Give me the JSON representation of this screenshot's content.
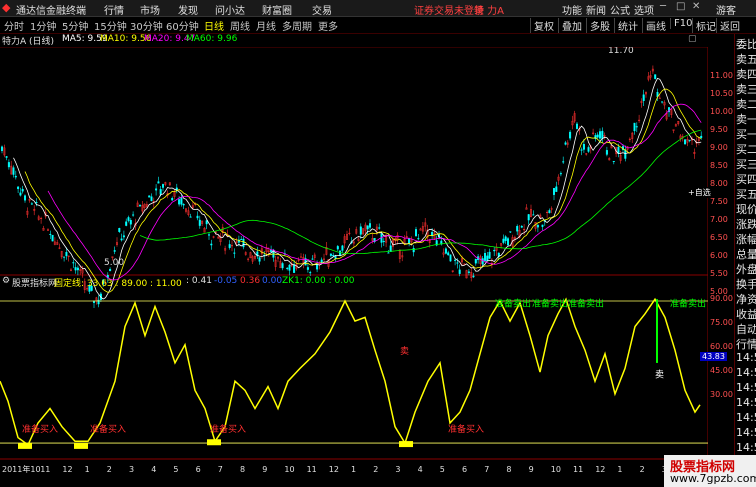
{
  "app": {
    "title": "通达信金融终端"
  },
  "menu": {
    "items": [
      "行情",
      "市场",
      "发现",
      "问小达",
      "财富圈",
      "交易"
    ]
  },
  "warning": "证券交易未登录",
  "current_stock": "特 力A",
  "right_menu": {
    "items": [
      "功能",
      "新闻",
      "公式",
      "选项"
    ],
    "user": "游客"
  },
  "toolbar": {
    "periods": [
      "分时",
      "1分钟",
      "5分钟",
      "15分钟",
      "30分钟",
      "60分钟",
      "日线",
      "周线",
      "月线",
      "多周期",
      "更多"
    ],
    "active": "日线",
    "tools": [
      "复权",
      "叠加",
      "多股",
      "统计",
      "画线",
      "F10",
      "标记",
      "返回"
    ]
  },
  "ma_header": {
    "stock": "特力A (日线)",
    "ma5": "MA5: 9.59",
    "ma10": "MA10: 9.56",
    "ma20": "MA20: 9.47",
    "ma60": "MA60: 9.96"
  },
  "price_axis": [
    "11.00",
    "10.50",
    "10.00",
    "9.50",
    "9.00",
    "8.50",
    "8.00",
    "7.50",
    "7.00",
    "6.50",
    "6.00",
    "5.50",
    "5.00"
  ],
  "price_labels": {
    "high": "11.70",
    "low": "5.00",
    "self_select": "+自选"
  },
  "indicator": {
    "title": "股票指标网",
    "fixed_line": "固定线: 33.63 : 89.00 : 11.00",
    "v1": ": 0.41",
    "v2": "-0.05",
    "v3": "0.36",
    "v4": "0.00",
    "zk": "ZK1: 0.00 : 0.00",
    "buy_label": "准备买入",
    "sell_label": "准备卖出",
    "sell_short": "卖",
    "axis": [
      "90.00",
      "75.00",
      "60.00",
      "45.00",
      "30.00"
    ],
    "current_val": "43.83"
  },
  "time_axis": [
    "2011年10",
    "11",
    "12",
    "1",
    "2",
    "3",
    "4",
    "5",
    "6",
    "7",
    "8",
    "9",
    "10",
    "11",
    "12",
    "1",
    "2",
    "3",
    "4",
    "5",
    "6",
    "7",
    "8",
    "9",
    "10",
    "11",
    "12",
    "1",
    "2",
    "3",
    "4",
    "5"
  ],
  "right_panel": [
    "委比",
    "卖五",
    "卖四",
    "卖三",
    "卖二",
    "卖一",
    "买一",
    "买二",
    "买三",
    "买四",
    "买五",
    "现价",
    "涨跌",
    "涨幅",
    "总量",
    "外盘",
    "换手",
    "净资",
    "收益",
    "自动",
    "行情",
    "14:5",
    "14:5",
    "14:5",
    "14:5",
    "14:5",
    "14:5",
    "14:5",
    "14:5"
  ],
  "watermark": {
    "line1": "股票指标网",
    "line2": "www.7gpzb.com"
  },
  "colors": {
    "up": "#ff3030",
    "down": "#00ffff",
    "ma5": "#ffffff",
    "ma10": "#ffff00",
    "ma20": "#ff00ff",
    "ma60": "#00ff00",
    "indicator": "#ffff00"
  }
}
